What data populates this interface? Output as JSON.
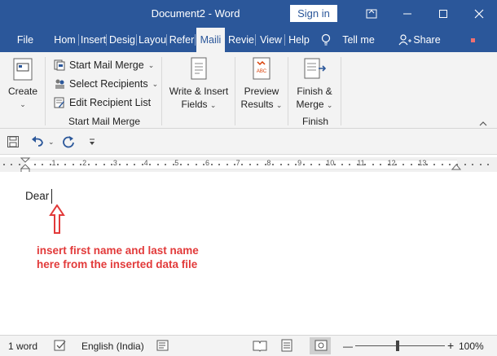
{
  "titlebar": {
    "title": "Document2  -  Word",
    "signin": "Sign in"
  },
  "tabs": [
    "File",
    "Hom",
    "Insert",
    "Desig",
    "Layou",
    "Refer",
    "Maili",
    "Revie",
    "View",
    "Help"
  ],
  "tellme": "Tell me",
  "share": "Share",
  "ribbon": {
    "create_label": "Create",
    "start_mail_merge": "Start Mail Merge",
    "select_recipients": "Select Recipients",
    "edit_recipient_list": "Edit Recipient List",
    "group_start": "Start Mail Merge",
    "write_insert_line1": "Write & Insert",
    "write_insert_line2": "Fields",
    "preview_line1": "Preview",
    "preview_line2": "Results",
    "finish_line1": "Finish &",
    "finish_line2": "Merge",
    "group_finish": "Finish"
  },
  "ruler": {
    "numbers": [
      "1",
      "2",
      "3",
      "4",
      "5",
      "6",
      "7",
      "8",
      "9",
      "10",
      "11",
      "12",
      "13"
    ]
  },
  "document": {
    "text": "Dear",
    "annotation": "insert first name and last name here from the inserted data file"
  },
  "status": {
    "words": "1 word",
    "language": "English (India)",
    "zoom": "100%"
  },
  "colors": {
    "brand": "#2b579a",
    "annotation": "#e23a3a"
  }
}
